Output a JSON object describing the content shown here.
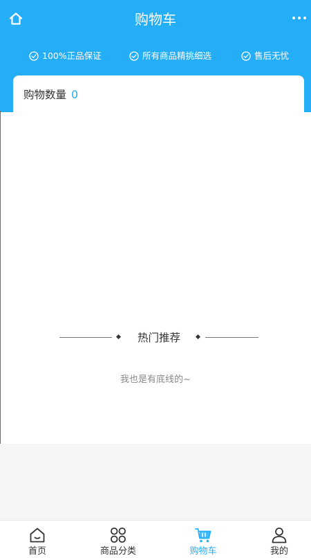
{
  "header": {
    "title": "购物车",
    "guarantees": [
      "100%正品保证",
      "所有商品精挑细选",
      "售后无忧"
    ]
  },
  "cart": {
    "count_label": "购物数量",
    "count_value": "0"
  },
  "recommend": {
    "title": "热门推荐",
    "bottom_hint": "我也是有底线的~"
  },
  "tabbar": {
    "items": [
      {
        "label": "首页",
        "icon": "home-icon"
      },
      {
        "label": "商品分类",
        "icon": "category-icon"
      },
      {
        "label": "购物车",
        "icon": "cart-icon"
      },
      {
        "label": "我的",
        "icon": "user-icon"
      }
    ],
    "active_index": 2
  },
  "colors": {
    "accent": "#25aef8",
    "text": "#333333",
    "muted": "#888888",
    "gray_bg": "#f6f6f6"
  }
}
